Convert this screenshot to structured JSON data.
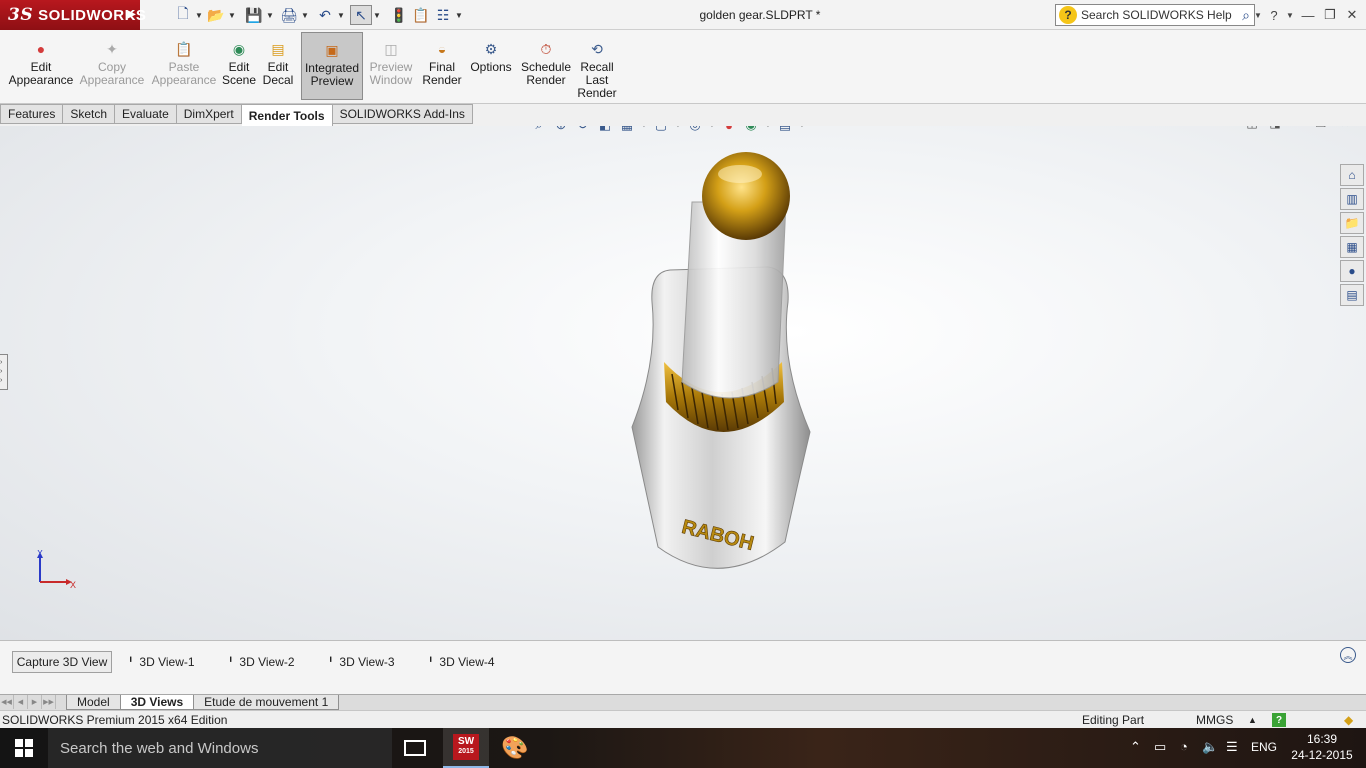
{
  "app": {
    "brand": "SOLIDWORKS",
    "brand_prefix": "3S",
    "document_title": "golden gear.SLDPRT *",
    "search_placeholder": "Search SOLIDWORKS Help"
  },
  "quick_access": [
    {
      "name": "new-document-icon",
      "glyph": "🗋"
    },
    {
      "name": "open-folder-icon",
      "glyph": "📂"
    },
    {
      "name": "save-icon",
      "glyph": "💾"
    },
    {
      "name": "print-icon",
      "glyph": "🖨"
    },
    {
      "name": "undo-icon",
      "glyph": "↶"
    },
    {
      "name": "select-cursor-icon",
      "glyph": "↖"
    },
    {
      "name": "rebuild-icon",
      "glyph": "🚦"
    },
    {
      "name": "file-properties-icon",
      "glyph": "📋"
    },
    {
      "name": "options-icon",
      "glyph": "☷"
    }
  ],
  "ribbon": [
    {
      "label": "Edit\nAppearance",
      "icon": "appearance-icon",
      "glyph": "●",
      "color": "#d43c3c",
      "state": "enabled"
    },
    {
      "label": "Copy\nAppearance",
      "icon": "copy-appearance-icon",
      "glyph": "✦",
      "color": "#aaaaaa",
      "state": "disabled"
    },
    {
      "label": "Paste\nAppearance",
      "icon": "paste-appearance-icon",
      "glyph": "📋",
      "color": "#aaaaaa",
      "state": "disabled"
    },
    {
      "label": "Edit\nScene",
      "icon": "scene-icon",
      "glyph": "◉",
      "color": "#2e8b57",
      "state": "enabled"
    },
    {
      "label": "Edit\nDecal",
      "icon": "decal-icon",
      "glyph": "▤",
      "color": "#d99a1a",
      "state": "enabled"
    },
    {
      "label": "Integrated\nPreview",
      "icon": "integrated-preview-icon",
      "glyph": "▣",
      "color": "#c66a1a",
      "state": "active"
    },
    {
      "label": "Preview\nWindow",
      "icon": "preview-window-icon",
      "glyph": "◫",
      "color": "#aaaaaa",
      "state": "disabled"
    },
    {
      "label": "Final\nRender",
      "icon": "final-render-icon",
      "glyph": "◒",
      "color": "#c6771a",
      "state": "enabled"
    },
    {
      "label": "Options",
      "icon": "render-options-icon",
      "glyph": "⚙",
      "color": "#3a5a8c",
      "state": "enabled"
    },
    {
      "label": "Schedule\nRender",
      "icon": "schedule-render-icon",
      "glyph": "⏱",
      "color": "#b8361e",
      "state": "enabled"
    },
    {
      "label": "Recall\nLast\nRender",
      "icon": "recall-last-render-icon",
      "glyph": "⟲",
      "color": "#3a5a8c",
      "state": "enabled"
    }
  ],
  "tabs": [
    {
      "label": "Features",
      "active": false
    },
    {
      "label": "Sketch",
      "active": false
    },
    {
      "label": "Evaluate",
      "active": false
    },
    {
      "label": "DimXpert",
      "active": false
    },
    {
      "label": "Render Tools",
      "active": true
    },
    {
      "label": "SOLIDWORKS Add-Ins",
      "active": false
    }
  ],
  "view_toolbar": [
    {
      "name": "zoom-to-fit-icon",
      "glyph": "⌕"
    },
    {
      "name": "zoom-to-area-icon",
      "glyph": "⊕"
    },
    {
      "name": "previous-view-icon",
      "glyph": "↺"
    },
    {
      "name": "section-view-icon",
      "glyph": "◧"
    },
    {
      "name": "view-orientation-icon",
      "glyph": "▦"
    },
    {
      "name": "display-style-icon",
      "glyph": "▢"
    },
    {
      "name": "hide-show-items-icon",
      "glyph": "◎"
    },
    {
      "name": "edit-appearance-icon",
      "glyph": "●"
    },
    {
      "name": "apply-scene-icon",
      "glyph": "◉"
    },
    {
      "name": "view-settings-icon",
      "glyph": "▤"
    }
  ],
  "side_panel": [
    {
      "name": "solidworks-resources-icon",
      "glyph": "⌂"
    },
    {
      "name": "design-library-icon",
      "glyph": "▥"
    },
    {
      "name": "file-explorer-icon",
      "glyph": "📁"
    },
    {
      "name": "view-palette-icon",
      "glyph": "▦"
    },
    {
      "name": "appearances-scenes-decals-icon",
      "glyph": "●"
    },
    {
      "name": "custom-properties-icon",
      "glyph": "▤"
    }
  ],
  "model": {
    "decal_text": "RABOH",
    "gold": "#d4a017",
    "silver": "#d8d8d8"
  },
  "triad": {
    "x_label": "X",
    "y_label": "Y"
  },
  "views_panel": {
    "capture_label": "Capture 3D View",
    "views": [
      "3D View-1",
      "3D View-2",
      "3D View-3",
      "3D View-4"
    ]
  },
  "bottom_tabs": [
    {
      "label": "Model",
      "active": false
    },
    {
      "label": "3D Views",
      "active": true
    },
    {
      "label": "Etude de mouvement 1",
      "active": false
    }
  ],
  "status": {
    "edition": "SOLIDWORKS Premium 2015 x64 Edition",
    "mode": "Editing Part",
    "units": "MMGS",
    "help": "?"
  },
  "taskbar": {
    "search_placeholder": "Search the web and Windows",
    "sw_badge": "SW",
    "sw_year": "2015",
    "language": "ENG",
    "time": "16:39",
    "date": "24-12-2015"
  },
  "colors": {
    "accent_red": "#b8181e",
    "taskbar_active": "#8fb8e8"
  }
}
